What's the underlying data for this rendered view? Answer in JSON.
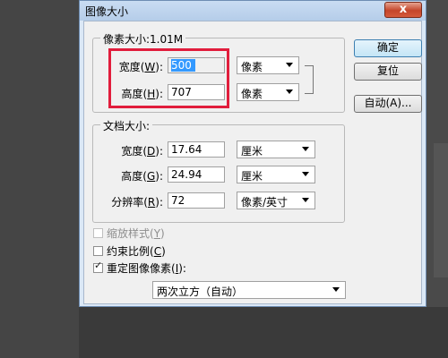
{
  "dialog": {
    "title": "图像大小",
    "close_label": "x"
  },
  "pixel_dimensions": {
    "legend": "像素大小:1.01M",
    "width": {
      "label": "宽度",
      "mnemonic": "W",
      "value": "500",
      "unit": "像素"
    },
    "height": {
      "label": "高度",
      "mnemonic": "H",
      "value": "707",
      "unit": "像素"
    }
  },
  "document_size": {
    "legend": "文档大小:",
    "width": {
      "label": "宽度",
      "mnemonic": "D",
      "value": "17.64",
      "unit": "厘米"
    },
    "height": {
      "label": "高度",
      "mnemonic": "G",
      "value": "24.94",
      "unit": "厘米"
    },
    "resolution": {
      "label": "分辨率",
      "mnemonic": "R",
      "value": "72",
      "unit": "像素/英寸"
    }
  },
  "buttons": {
    "ok": "确定",
    "reset": "复位",
    "auto": "自动(A)..."
  },
  "options": {
    "scale_styles": {
      "label": "缩放样式",
      "mnemonic": "Y",
      "checked": false,
      "enabled": false
    },
    "constrain_proportions": {
      "label": "约束比例",
      "mnemonic": "C",
      "checked": false,
      "enabled": true
    },
    "resample": {
      "label": "重定图像像素",
      "mnemonic": "I",
      "checked": true,
      "enabled": true
    },
    "resample_method": "两次立方（自动）"
  },
  "colors": {
    "highlight": "#e11d3c",
    "title_bar": "#c9dcf2",
    "close_button": "#c4452b"
  }
}
